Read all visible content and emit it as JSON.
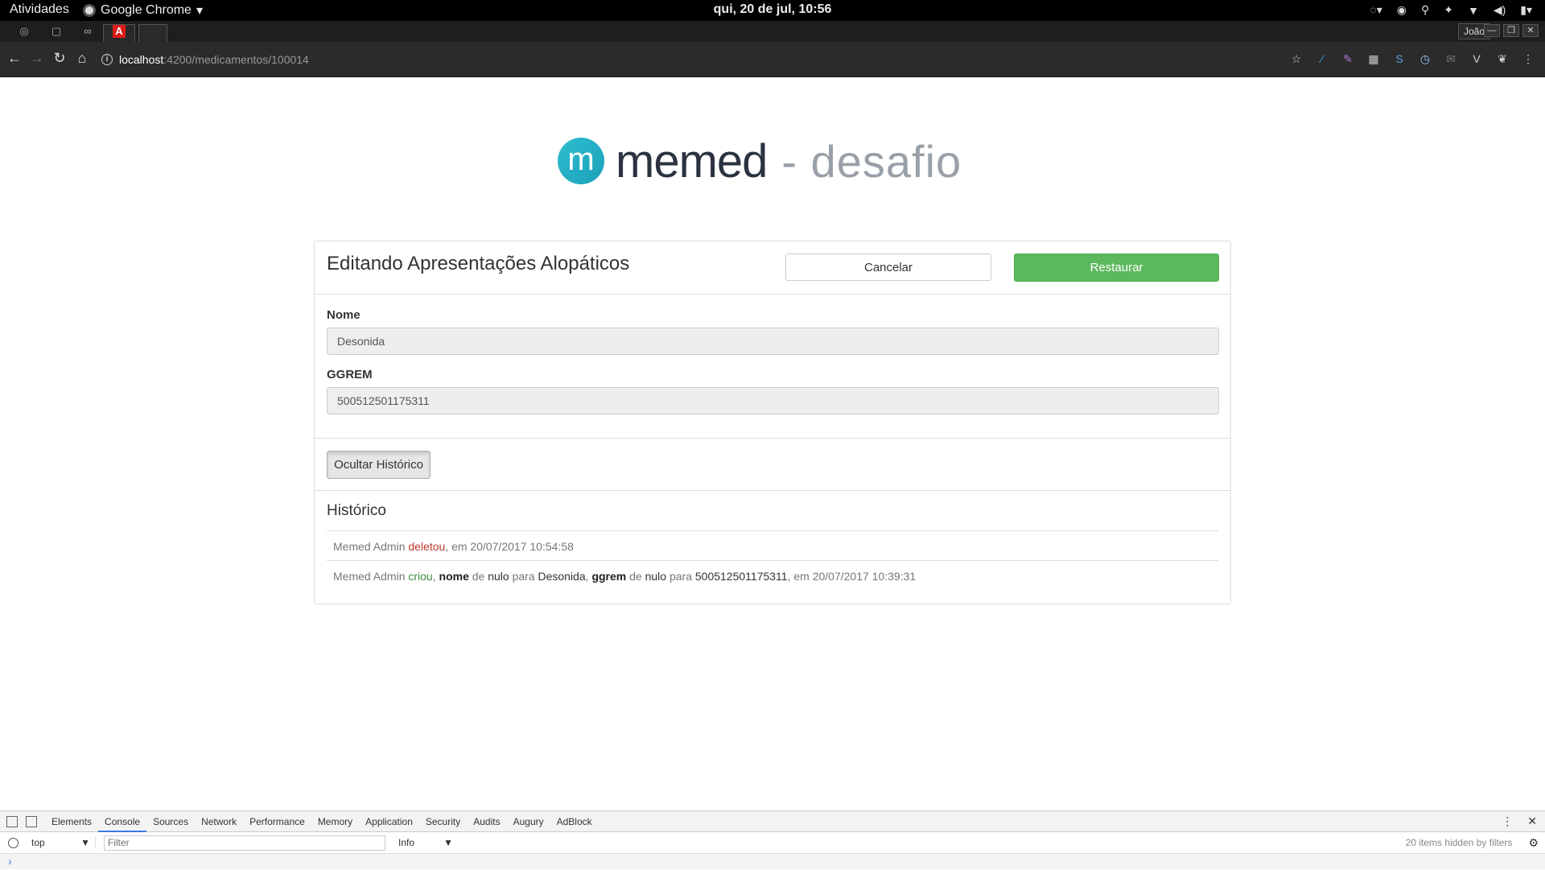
{
  "topbar": {
    "activities": "Atividades",
    "app_name": "Google Chrome",
    "clock": "qui, 20 de jul, 10:56"
  },
  "chrome": {
    "user": "João",
    "url_host": "localhost",
    "url_path": ":4200/medicamentos/100014"
  },
  "logo": {
    "letter": "m",
    "word": "memed",
    "subtitle": "- desafio"
  },
  "panel": {
    "title": "Editando Apresentações Alopáticos",
    "cancel_label": "Cancelar",
    "restore_label": "Restaurar",
    "restore_color": "#5cb85c",
    "fields": {
      "nome_label": "Nome",
      "nome_value": "Desonida",
      "ggrem_label": "GGREM",
      "ggrem_value": "500512501175311"
    },
    "toggle_history_label": "Ocultar Histórico"
  },
  "history": {
    "title": "Histórico",
    "entries": [
      {
        "user": "Memed Admin",
        "action": "deletou",
        "suffix": ", em 20/07/2017 10:54:58"
      },
      {
        "user": "Memed Admin",
        "action": "criou",
        "sep": ",",
        "field1": "nome",
        "de": "de",
        "from1": "nulo",
        "para": "para",
        "to1": "Desonida",
        "sep2": ",",
        "field2": "ggrem",
        "from2": "nulo",
        "to2": "500512501175311",
        "suffix": ", em 20/07/2017 10:39:31"
      }
    ]
  },
  "devtools": {
    "tabs": [
      "Elements",
      "Console",
      "Sources",
      "Network",
      "Performance",
      "Memory",
      "Application",
      "Security",
      "Audits",
      "Augury",
      "AdBlock"
    ],
    "context": "top",
    "filter_placeholder": "Filter",
    "level": "Info",
    "hidden_note": "20 items hidden by filters",
    "prompt": "›"
  }
}
